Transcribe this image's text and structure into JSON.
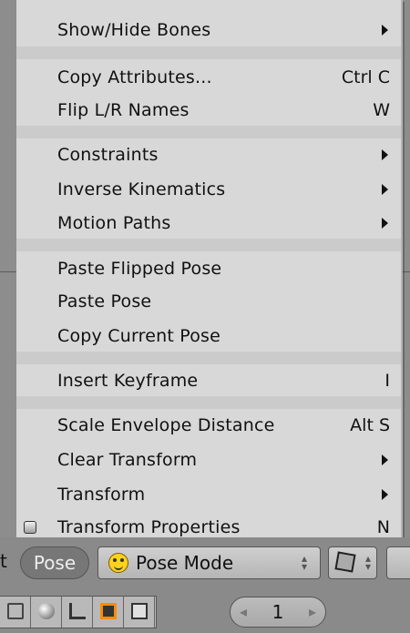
{
  "menu": {
    "items": [
      {
        "label": "Show/Hide Bones",
        "shortcut": "",
        "submenu": true
      },
      {
        "label": "Copy Attributes...",
        "shortcut": "Ctrl C",
        "submenu": false
      },
      {
        "label": "Flip L/R Names",
        "shortcut": "W",
        "submenu": false
      },
      {
        "label": "Constraints",
        "shortcut": "",
        "submenu": true
      },
      {
        "label": "Inverse Kinematics",
        "shortcut": "",
        "submenu": true
      },
      {
        "label": "Motion Paths",
        "shortcut": "",
        "submenu": true
      },
      {
        "label": "Paste Flipped Pose",
        "shortcut": "",
        "submenu": false
      },
      {
        "label": "Paste Pose",
        "shortcut": "",
        "submenu": false
      },
      {
        "label": "Copy Current Pose",
        "shortcut": "",
        "submenu": false
      },
      {
        "label": "Insert Keyframe",
        "shortcut": "I",
        "submenu": false
      },
      {
        "label": "Scale Envelope Distance",
        "shortcut": "Alt S",
        "submenu": false
      },
      {
        "label": "Clear Transform",
        "shortcut": "",
        "submenu": true
      },
      {
        "label": "Transform",
        "shortcut": "",
        "submenu": true
      },
      {
        "label": "Transform Properties",
        "shortcut": "N",
        "submenu": false,
        "checkbox": true
      }
    ]
  },
  "header": {
    "cut_text": "t",
    "pose_menu_label": "Pose",
    "mode_select_value": "Pose Mode"
  },
  "toolbar": {
    "frame_value": "1",
    "icons": [
      "list-icon",
      "sphere-icon",
      "axis-icon",
      "square-icon",
      "image-icon"
    ]
  }
}
